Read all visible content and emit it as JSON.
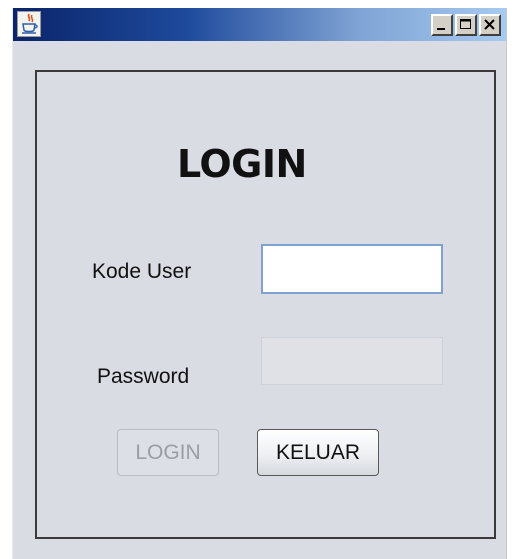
{
  "window": {
    "title": "",
    "app_icon": "java-cup-icon",
    "controls": {
      "minimize": "minimize-icon",
      "maximize": "maximize-icon",
      "close": "close-icon"
    },
    "colors": {
      "titlebar_start": "#0a246a",
      "titlebar_end": "#a6caf0",
      "background": "#d9dce3"
    }
  },
  "form": {
    "heading": "LOGIN",
    "kode_user_label": "Kode User",
    "kode_user_value": "",
    "password_label": "Password",
    "password_value": "",
    "password_enabled": false,
    "login_button_label": "LOGIN",
    "login_button_enabled": false,
    "keluar_button_label": "KELUAR"
  }
}
